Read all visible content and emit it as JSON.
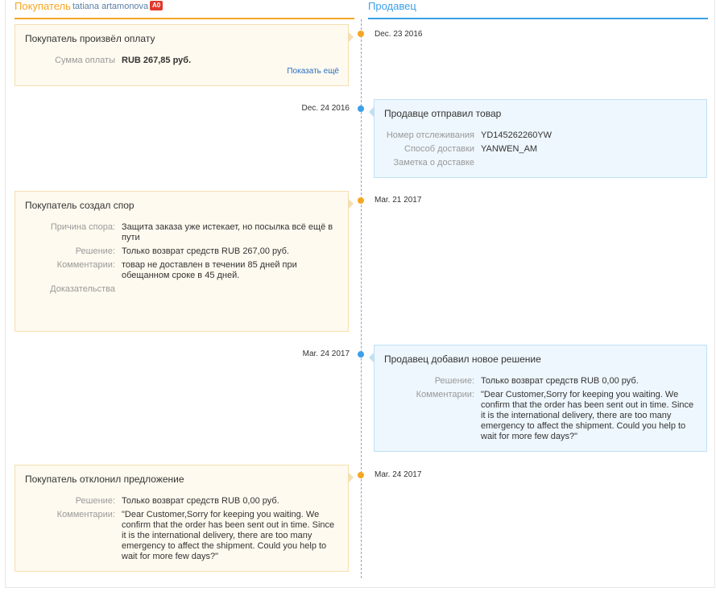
{
  "header": {
    "buyer_title": "Покупатель",
    "buyer_name": "tatiana artamonova",
    "buyer_badge": "A0",
    "seller_title": "Продавец"
  },
  "colors": {
    "buyer_accent": "#f5a623",
    "seller_accent": "#3ba0e8",
    "badge": "#e0392b"
  },
  "events": [
    {
      "side": "buyer",
      "date": "Dec. 23 2016",
      "title": "Покупатель произвёл оплату",
      "fields": [
        {
          "label": "Сумма оплаты",
          "value": "RUB 267,85 руб."
        }
      ],
      "link": "Показать ещё"
    },
    {
      "side": "seller",
      "date": "Dec. 24 2016",
      "title": "Продавце отправил товар",
      "fields": [
        {
          "label": "Номер отслеживания",
          "value": "YD145262260YW"
        },
        {
          "label": "Способ доставки",
          "value": "YANWEN_AM"
        },
        {
          "label": "Заметка о доставке",
          "value": ""
        }
      ]
    },
    {
      "side": "buyer",
      "date": "Mar. 21 2017",
      "title": "Покупатель создал спор",
      "fields": [
        {
          "label": "Причина спора:",
          "value": "Защита заказа уже истекает, но посылка всё ещё в пути"
        },
        {
          "label": "Решение:",
          "value": "Только возврат средств RUB 267,00 руб."
        },
        {
          "label": "Комментарии:",
          "value": "товар не доставлен в течении 85 дней при обещанном сроке в 45 дней."
        },
        {
          "label": "Доказательства",
          "value": ""
        }
      ]
    },
    {
      "side": "seller",
      "date": "Mar. 24 2017",
      "title": "Продавец добавил новое решение",
      "fields": [
        {
          "label": "Решение:",
          "value": "Только возврат средств RUB 0,00 руб."
        },
        {
          "label": "Комментарии:",
          "value": "\"Dear Customer,Sorry for keeping you waiting. We confirm that the order has been sent out in time. Since it is the international delivery, there are too many emergency to affect the shipment. Could you help to wait for more few days?\""
        }
      ]
    },
    {
      "side": "buyer",
      "date": "Mar. 24 2017",
      "title": "Покупатель отклонил предложение",
      "fields": [
        {
          "label": "Решение:",
          "value": "Только возврат средств RUB 0,00 руб."
        },
        {
          "label": "Комментарии:",
          "value": "\"Dear Customer,Sorry for keeping you waiting. We confirm that the order has been sent out in time. Since it is the international delivery, there are too many emergency to affect the shipment. Could you help to wait for more few days?\""
        }
      ]
    }
  ]
}
